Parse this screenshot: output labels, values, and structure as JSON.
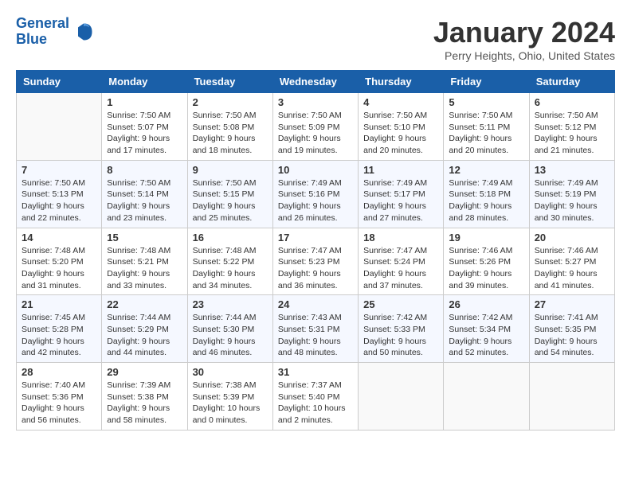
{
  "header": {
    "logo_line1": "General",
    "logo_line2": "Blue",
    "month_title": "January 2024",
    "location": "Perry Heights, Ohio, United States"
  },
  "days_of_week": [
    "Sunday",
    "Monday",
    "Tuesday",
    "Wednesday",
    "Thursday",
    "Friday",
    "Saturday"
  ],
  "weeks": [
    [
      {
        "day": "",
        "info": ""
      },
      {
        "day": "1",
        "info": "Sunrise: 7:50 AM\nSunset: 5:07 PM\nDaylight: 9 hours\nand 17 minutes."
      },
      {
        "day": "2",
        "info": "Sunrise: 7:50 AM\nSunset: 5:08 PM\nDaylight: 9 hours\nand 18 minutes."
      },
      {
        "day": "3",
        "info": "Sunrise: 7:50 AM\nSunset: 5:09 PM\nDaylight: 9 hours\nand 19 minutes."
      },
      {
        "day": "4",
        "info": "Sunrise: 7:50 AM\nSunset: 5:10 PM\nDaylight: 9 hours\nand 20 minutes."
      },
      {
        "day": "5",
        "info": "Sunrise: 7:50 AM\nSunset: 5:11 PM\nDaylight: 9 hours\nand 20 minutes."
      },
      {
        "day": "6",
        "info": "Sunrise: 7:50 AM\nSunset: 5:12 PM\nDaylight: 9 hours\nand 21 minutes."
      }
    ],
    [
      {
        "day": "7",
        "info": "Sunrise: 7:50 AM\nSunset: 5:13 PM\nDaylight: 9 hours\nand 22 minutes."
      },
      {
        "day": "8",
        "info": "Sunrise: 7:50 AM\nSunset: 5:14 PM\nDaylight: 9 hours\nand 23 minutes."
      },
      {
        "day": "9",
        "info": "Sunrise: 7:50 AM\nSunset: 5:15 PM\nDaylight: 9 hours\nand 25 minutes."
      },
      {
        "day": "10",
        "info": "Sunrise: 7:49 AM\nSunset: 5:16 PM\nDaylight: 9 hours\nand 26 minutes."
      },
      {
        "day": "11",
        "info": "Sunrise: 7:49 AM\nSunset: 5:17 PM\nDaylight: 9 hours\nand 27 minutes."
      },
      {
        "day": "12",
        "info": "Sunrise: 7:49 AM\nSunset: 5:18 PM\nDaylight: 9 hours\nand 28 minutes."
      },
      {
        "day": "13",
        "info": "Sunrise: 7:49 AM\nSunset: 5:19 PM\nDaylight: 9 hours\nand 30 minutes."
      }
    ],
    [
      {
        "day": "14",
        "info": "Sunrise: 7:48 AM\nSunset: 5:20 PM\nDaylight: 9 hours\nand 31 minutes."
      },
      {
        "day": "15",
        "info": "Sunrise: 7:48 AM\nSunset: 5:21 PM\nDaylight: 9 hours\nand 33 minutes."
      },
      {
        "day": "16",
        "info": "Sunrise: 7:48 AM\nSunset: 5:22 PM\nDaylight: 9 hours\nand 34 minutes."
      },
      {
        "day": "17",
        "info": "Sunrise: 7:47 AM\nSunset: 5:23 PM\nDaylight: 9 hours\nand 36 minutes."
      },
      {
        "day": "18",
        "info": "Sunrise: 7:47 AM\nSunset: 5:24 PM\nDaylight: 9 hours\nand 37 minutes."
      },
      {
        "day": "19",
        "info": "Sunrise: 7:46 AM\nSunset: 5:26 PM\nDaylight: 9 hours\nand 39 minutes."
      },
      {
        "day": "20",
        "info": "Sunrise: 7:46 AM\nSunset: 5:27 PM\nDaylight: 9 hours\nand 41 minutes."
      }
    ],
    [
      {
        "day": "21",
        "info": "Sunrise: 7:45 AM\nSunset: 5:28 PM\nDaylight: 9 hours\nand 42 minutes."
      },
      {
        "day": "22",
        "info": "Sunrise: 7:44 AM\nSunset: 5:29 PM\nDaylight: 9 hours\nand 44 minutes."
      },
      {
        "day": "23",
        "info": "Sunrise: 7:44 AM\nSunset: 5:30 PM\nDaylight: 9 hours\nand 46 minutes."
      },
      {
        "day": "24",
        "info": "Sunrise: 7:43 AM\nSunset: 5:31 PM\nDaylight: 9 hours\nand 48 minutes."
      },
      {
        "day": "25",
        "info": "Sunrise: 7:42 AM\nSunset: 5:33 PM\nDaylight: 9 hours\nand 50 minutes."
      },
      {
        "day": "26",
        "info": "Sunrise: 7:42 AM\nSunset: 5:34 PM\nDaylight: 9 hours\nand 52 minutes."
      },
      {
        "day": "27",
        "info": "Sunrise: 7:41 AM\nSunset: 5:35 PM\nDaylight: 9 hours\nand 54 minutes."
      }
    ],
    [
      {
        "day": "28",
        "info": "Sunrise: 7:40 AM\nSunset: 5:36 PM\nDaylight: 9 hours\nand 56 minutes."
      },
      {
        "day": "29",
        "info": "Sunrise: 7:39 AM\nSunset: 5:38 PM\nDaylight: 9 hours\nand 58 minutes."
      },
      {
        "day": "30",
        "info": "Sunrise: 7:38 AM\nSunset: 5:39 PM\nDaylight: 10 hours\nand 0 minutes."
      },
      {
        "day": "31",
        "info": "Sunrise: 7:37 AM\nSunset: 5:40 PM\nDaylight: 10 hours\nand 2 minutes."
      },
      {
        "day": "",
        "info": ""
      },
      {
        "day": "",
        "info": ""
      },
      {
        "day": "",
        "info": ""
      }
    ]
  ]
}
